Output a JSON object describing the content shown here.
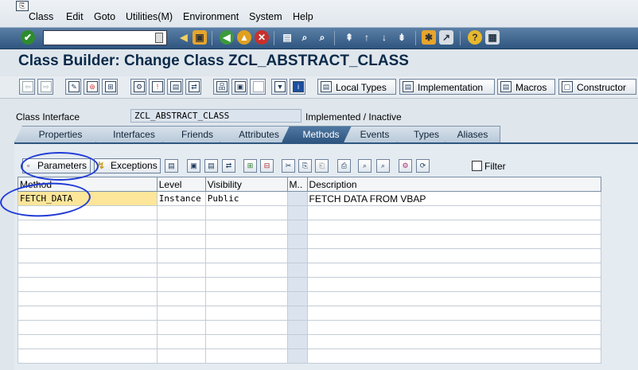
{
  "menu": [
    "Class",
    "Edit",
    "Goto",
    "Utilities(M)",
    "Environment",
    "System",
    "Help"
  ],
  "title": "Class Builder: Change Class ZCL_ABSTRACT_CLASS",
  "app_toolbar": {
    "local_types": "Local Types",
    "implementation": "Implementation",
    "macros": "Macros",
    "constructor": "Constructor"
  },
  "class_interface": {
    "label": "Class Interface",
    "value": "ZCL_ABSTRACT_CLASS",
    "status": "Implemented / Inactive"
  },
  "tabs": [
    "Properties",
    "Interfaces",
    "Friends",
    "Attributes",
    "Methods",
    "Events",
    "Types",
    "Aliases"
  ],
  "active_tab": "Methods",
  "grid_toolbar": {
    "parameters": "Parameters",
    "exceptions": "Exceptions",
    "filter": "Filter"
  },
  "table": {
    "columns": [
      "Method",
      "Level",
      "Visibility",
      "M..",
      "Description"
    ],
    "rows": [
      [
        "FETCH_DATA",
        "Instance",
        "Public",
        "",
        "FETCH DATA FROM VBAP"
      ]
    ]
  }
}
